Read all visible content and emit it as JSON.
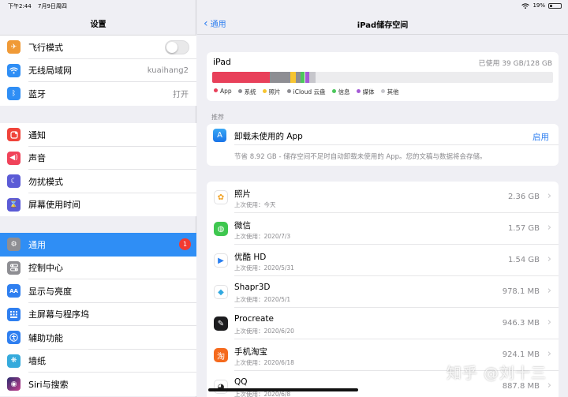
{
  "status": {
    "time": "下午2:44",
    "date": "7月9日周四",
    "battery": "19%"
  },
  "sidebar": {
    "title": "设置",
    "group1": [
      {
        "label": "飞行模式",
        "icon": "airplane-icon",
        "color": "#f09a37",
        "toggle": false
      },
      {
        "label": "无线局域网",
        "icon": "wifi-icon",
        "color": "#2f8ef5",
        "value": "kuaihang2"
      },
      {
        "label": "蓝牙",
        "icon": "bluetooth-icon",
        "color": "#2f8ef5",
        "value": "打开"
      }
    ],
    "group2": [
      {
        "label": "通知",
        "icon": "notification-icon",
        "color": "#f0433a"
      },
      {
        "label": "声音",
        "icon": "sound-icon",
        "color": "#f0435a"
      },
      {
        "label": "勿扰模式",
        "icon": "moon-icon",
        "color": "#5b5bd6"
      },
      {
        "label": "屏幕使用时间",
        "icon": "hourglass-icon",
        "color": "#5b5bd6"
      }
    ],
    "group3": [
      {
        "label": "通用",
        "icon": "gear-icon",
        "color": "#8e8e93",
        "badge": "1",
        "selected": true
      },
      {
        "label": "控制中心",
        "icon": "toggles-icon",
        "color": "#8e8e93"
      },
      {
        "label": "显示与亮度",
        "icon": "display-icon",
        "color": "#2f7ff0"
      },
      {
        "label": "主屏幕与程序坞",
        "icon": "homescreen-icon",
        "color": "#2f7ff0"
      },
      {
        "label": "辅助功能",
        "icon": "accessibility-icon",
        "color": "#2f7ff0"
      },
      {
        "label": "墙纸",
        "icon": "wallpaper-icon",
        "color": "#35aadc"
      },
      {
        "label": "Siri与搜索",
        "icon": "siri-icon",
        "color": "#222222"
      }
    ]
  },
  "nav": {
    "back": "通用",
    "title": "iPad储存空间"
  },
  "storage": {
    "device": "iPad",
    "used": "已使用 39 GB/128 GB",
    "segments": [
      {
        "name": "App",
        "color": "#e8405a",
        "fraction": 0.17
      },
      {
        "name": "系统",
        "color": "#8e8e93",
        "fraction": 0.06
      },
      {
        "name": "照片",
        "color": "#f7c531",
        "fraction": 0.015
      },
      {
        "name": "iCloud 云盘",
        "color": "#8e8e93",
        "fraction": 0.015
      },
      {
        "name": "信息",
        "color": "#4cc75c",
        "fraction": 0.012
      },
      {
        "name": "媒体",
        "color": "#a45ad6",
        "fraction": 0.012
      },
      {
        "name": "其他",
        "color": "#c7c7cc",
        "fraction": 0.02
      }
    ],
    "legend": [
      {
        "name": "App",
        "color": "#e8405a"
      },
      {
        "name": "系统",
        "color": "#8e8e93"
      },
      {
        "name": "照片",
        "color": "#f7c531"
      },
      {
        "name": "iCloud 云盘",
        "color": "#8e8e93"
      },
      {
        "name": "信息",
        "color": "#4cc75c"
      },
      {
        "name": "媒体",
        "color": "#a45ad6"
      },
      {
        "name": "其他",
        "color": "#c7c7cc"
      }
    ]
  },
  "recommend": {
    "header": "推荐",
    "title": "卸载未使用的 App",
    "action": "启用",
    "desc": "节省 8.92 GB - 储存空间不足时自动卸载未使用的 App。您的文稿与数据将会存储。"
  },
  "apps": [
    {
      "name": "照片",
      "last": "上次使用：今天",
      "size": "2.36 GB",
      "icon": "photos-icon",
      "color": "#ffffff"
    },
    {
      "name": "微信",
      "last": "上次使用：2020/7/3",
      "size": "1.57 GB",
      "icon": "wechat-icon",
      "color": "#3ec74f"
    },
    {
      "name": "优酷 HD",
      "last": "上次使用：2020/5/31",
      "size": "1.54 GB",
      "icon": "youku-icon",
      "color": "#ffffff"
    },
    {
      "name": "Shapr3D",
      "last": "上次使用：2020/5/1",
      "size": "978.1 MB",
      "icon": "shapr3d-icon",
      "color": "#ffffff"
    },
    {
      "name": "Procreate",
      "last": "上次使用：2020/6/20",
      "size": "946.3 MB",
      "icon": "procreate-icon",
      "color": "#1c1c1e"
    },
    {
      "name": "手机淘宝",
      "last": "上次使用：2020/6/18",
      "size": "924.1 MB",
      "icon": "taobao-icon",
      "color": "#f56a1d"
    },
    {
      "name": "QQ",
      "last": "上次使用：2020/6/8",
      "size": "887.8 MB",
      "icon": "qq-icon",
      "color": "#ffffff"
    }
  ],
  "watermark": "知乎 @刘十三"
}
